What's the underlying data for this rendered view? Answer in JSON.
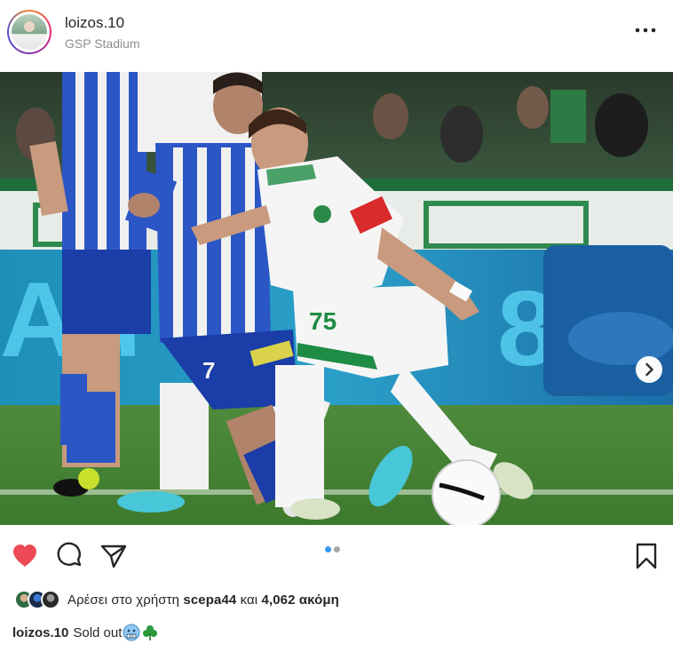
{
  "post": {
    "username": "loizos.10",
    "location": "GSP Stadium",
    "more_icon": "more-horizontal-icon"
  },
  "carousel": {
    "slide_index": 1,
    "slide_count": 2,
    "next_icon": "chevron-right-icon"
  },
  "actions": {
    "like_icon": "heart-filled-icon",
    "comment_icon": "comment-icon",
    "share_icon": "paper-plane-icon",
    "save_icon": "bookmark-icon"
  },
  "likes": {
    "prefix": "Αρέσει στο χρήστη",
    "user": "scepa44",
    "connector": "και",
    "count": "4,062 ακόμη"
  },
  "caption": {
    "username": "loizos.10",
    "text": "Sold out"
  },
  "colors": {
    "heart": "#ed4956",
    "active_dot": "#3897f0",
    "inactive_dot": "#a8a8a8",
    "text": "#262626",
    "secondary": "#8e8e8e"
  }
}
